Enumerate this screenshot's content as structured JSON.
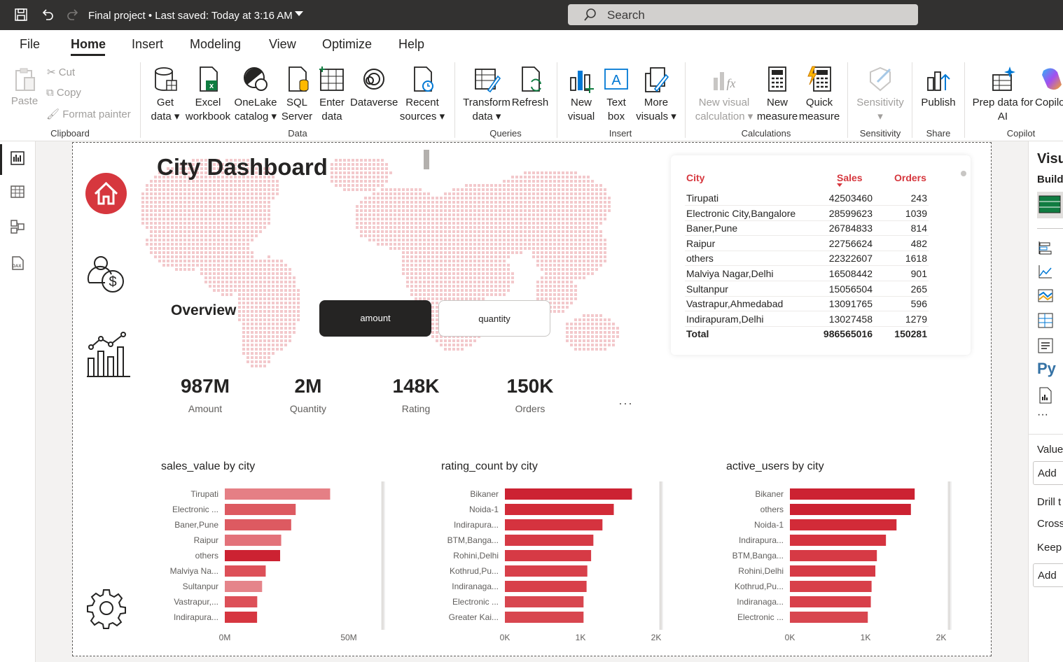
{
  "titlebar": {
    "document_title": "Final project  •  Last saved: Today at 3:16 AM",
    "search_placeholder": "Search"
  },
  "menu": {
    "items": [
      "File",
      "Home",
      "Insert",
      "Modeling",
      "View",
      "Optimize",
      "Help"
    ],
    "active": "Home"
  },
  "ribbon": {
    "clipboard": {
      "paste": "Paste",
      "cut": "Cut",
      "copy": "Copy",
      "format_painter": "Format painter",
      "group": "Clipboard"
    },
    "data": {
      "get_data": [
        "Get",
        "data"
      ],
      "excel": [
        "Excel",
        "workbook"
      ],
      "onelake": [
        "OneLake",
        "catalog"
      ],
      "sql": [
        "SQL",
        "Server"
      ],
      "enter": [
        "Enter",
        "data"
      ],
      "dataverse": "Dataverse",
      "recent": [
        "Recent",
        "sources"
      ],
      "group": "Data"
    },
    "queries": {
      "transform": [
        "Transform",
        "data"
      ],
      "refresh": "Refresh",
      "group": "Queries"
    },
    "insert": {
      "new_visual": [
        "New",
        "visual"
      ],
      "text_box": [
        "Text",
        "box"
      ],
      "more_visuals": [
        "More",
        "visuals"
      ],
      "group": "Insert"
    },
    "calculations": {
      "new_visual_calc": [
        "New visual",
        "calculation"
      ],
      "new_measure": [
        "New",
        "measure"
      ],
      "quick_measure": [
        "Quick",
        "measure"
      ],
      "group": "Calculations"
    },
    "sensitivity": {
      "label": "Sensitivity",
      "group": "Sensitivity"
    },
    "share": {
      "publish": "Publish",
      "group": "Share"
    },
    "copilot": {
      "prep_data": [
        "Prep data for",
        "AI"
      ],
      "copilot": "Copilo",
      "group": "Copilot"
    }
  },
  "dashboard": {
    "title": "City Dashboard",
    "overview_label": "Overview",
    "toggle": {
      "amount": "amount",
      "quantity": "quantity",
      "selected": "amount"
    },
    "kpis": [
      {
        "value": "987M",
        "label": "Amount"
      },
      {
        "value": "2M",
        "label": "Quantity"
      },
      {
        "value": "148K",
        "label": "Rating"
      },
      {
        "value": "150K",
        "label": "Orders"
      }
    ],
    "more_options": "···",
    "table": {
      "headers": [
        "City",
        "Sales",
        "Orders"
      ],
      "rows": [
        [
          "Tirupati",
          "42503460",
          "243"
        ],
        [
          "Electronic City,Bangalore",
          "28599623",
          "1039"
        ],
        [
          "Baner,Pune",
          "26784833",
          "814"
        ],
        [
          "Raipur",
          "22756624",
          "482"
        ],
        [
          "others",
          "22322607",
          "1618"
        ],
        [
          "Malviya Nagar,Delhi",
          "16508442",
          "901"
        ],
        [
          "Sultanpur",
          "15056504",
          "265"
        ],
        [
          "Vastrapur,Ahmedabad",
          "13091765",
          "596"
        ],
        [
          "Indirapuram,Delhi",
          "13027458",
          "1279"
        ]
      ],
      "total": [
        "Total",
        "986565016",
        "150281"
      ]
    }
  },
  "chart_data": [
    {
      "type": "bar",
      "title": "sales_value by city",
      "categories": [
        "Tirupati",
        "Electronic ...",
        "Baner,Pune",
        "Raipur",
        "others",
        "Malviya Na...",
        "Sultanpur",
        "Vastrapur,...",
        "Indirapura..."
      ],
      "values": [
        42503460,
        28599623,
        26784833,
        22756624,
        22322607,
        16508442,
        15056504,
        13091765,
        13027458
      ],
      "colors": [
        "#e57f85",
        "#dd5a61",
        "#dd5a61",
        "#e3727a",
        "#cc2232",
        "#dd5058",
        "#e5848a",
        "#dd5058",
        "#d63640"
      ],
      "xticks": [
        "0M",
        "50M"
      ],
      "xlim": [
        0,
        50000000
      ]
    },
    {
      "type": "bar",
      "title": "rating_count by city",
      "categories": [
        "Bikaner",
        "Noida-1",
        "Indirapura...",
        "BTM,Banga...",
        "Rohini,Delhi",
        "Kothrud,Pu...",
        "Indiranaga...",
        "Electronic ...",
        "Greater Kai..."
      ],
      "values": [
        1680,
        1440,
        1290,
        1170,
        1140,
        1090,
        1080,
        1040,
        1040
      ],
      "colors": [
        "#cc2232",
        "#d22b38",
        "#d5333f",
        "#d63a45",
        "#d63a45",
        "#d8404a",
        "#d8404a",
        "#d8464f",
        "#d8464f"
      ],
      "xticks": [
        "0K",
        "1K",
        "2K"
      ],
      "xlim": [
        0,
        2000
      ]
    },
    {
      "type": "bar",
      "title": "active_users by city",
      "categories": [
        "Bikaner",
        "others",
        "Noida-1",
        "Indirapura...",
        "BTM,Banga...",
        "Rohini,Delhi",
        "Kothrud,Pu...",
        "Indiranaga...",
        "Electronic ..."
      ],
      "values": [
        1650,
        1600,
        1410,
        1270,
        1150,
        1130,
        1080,
        1070,
        1030
      ],
      "colors": [
        "#cc2232",
        "#cc2232",
        "#d22b38",
        "#d5333f",
        "#d63a45",
        "#d63a45",
        "#d8404a",
        "#d8404a",
        "#d8464f"
      ],
      "xticks": [
        "0K",
        "1K",
        "2K"
      ],
      "xlim": [
        0,
        2000
      ]
    }
  ],
  "right_pane": {
    "title": "Visu",
    "build": "Build",
    "values": "Value",
    "add1": "Add",
    "drill": "Drill t",
    "cross": "Cross",
    "keep": "Keep",
    "add2": "Add"
  },
  "colors": {
    "accent_red": "#d6373e",
    "dark": "#252423",
    "titlebar": "#323130"
  }
}
